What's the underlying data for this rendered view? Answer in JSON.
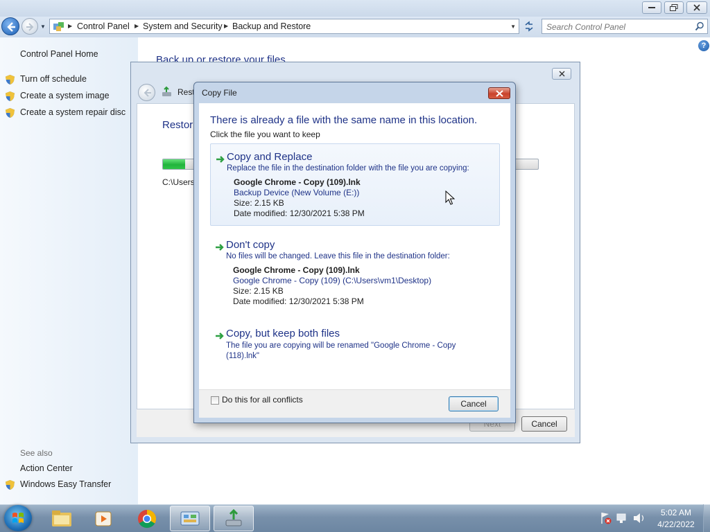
{
  "window": {
    "breadcrumbs": [
      "Control Panel",
      "System and Security",
      "Backup and Restore"
    ],
    "search_placeholder": "Search Control Panel"
  },
  "leftnav": {
    "home": "Control Panel Home",
    "items": [
      "Turn off schedule",
      "Create a system image",
      "Create a system repair disc"
    ],
    "see_also": "See also",
    "see_also_items": [
      "Action Center",
      "Windows Easy Transfer"
    ]
  },
  "main": {
    "page_title": "Back up or restore your files"
  },
  "wizard": {
    "title": "Rest",
    "heading": "Restor",
    "path_text": "C:\\Users\\",
    "progress_fraction": 0.06,
    "next_label": "Next",
    "cancel_label": "Cancel"
  },
  "dialog": {
    "title": "Copy File",
    "heading": "There is already a file with the same name in this location.",
    "subheading": "Click the file you want to keep",
    "options": [
      {
        "title": "Copy and Replace",
        "description": "Replace the file in the destination folder with the file you are copying:",
        "file_name": "Google Chrome - Copy (109).lnk",
        "location": "Backup Device (New Volume (E:))",
        "size": "Size: 2.15 KB",
        "date": "Date modified: 12/30/2021 5:38 PM"
      },
      {
        "title": "Don't copy",
        "description": "No files will be changed. Leave this file in the destination folder:",
        "file_name": "Google Chrome - Copy (109).lnk",
        "location": "Google Chrome - Copy (109) (C:\\Users\\vm1\\Desktop)",
        "size": "Size: 2.15 KB",
        "date": "Date modified: 12/30/2021 5:38 PM"
      },
      {
        "title": "Copy, but keep both files",
        "description": "The file you are copying will be renamed \"Google Chrome - Copy (118).lnk\""
      }
    ],
    "checkbox_label": "Do this for all conflicts",
    "cancel_label": "Cancel"
  },
  "taskbar": {
    "time": "5:02 AM",
    "date": "4/22/2022",
    "items": [
      "explorer-icon",
      "media-player-icon",
      "chrome-icon",
      "control-panel-icon",
      "backup-restore-icon"
    ]
  },
  "colors": {
    "heading_blue": "#1e3287",
    "progress_green": "#21b43c"
  }
}
